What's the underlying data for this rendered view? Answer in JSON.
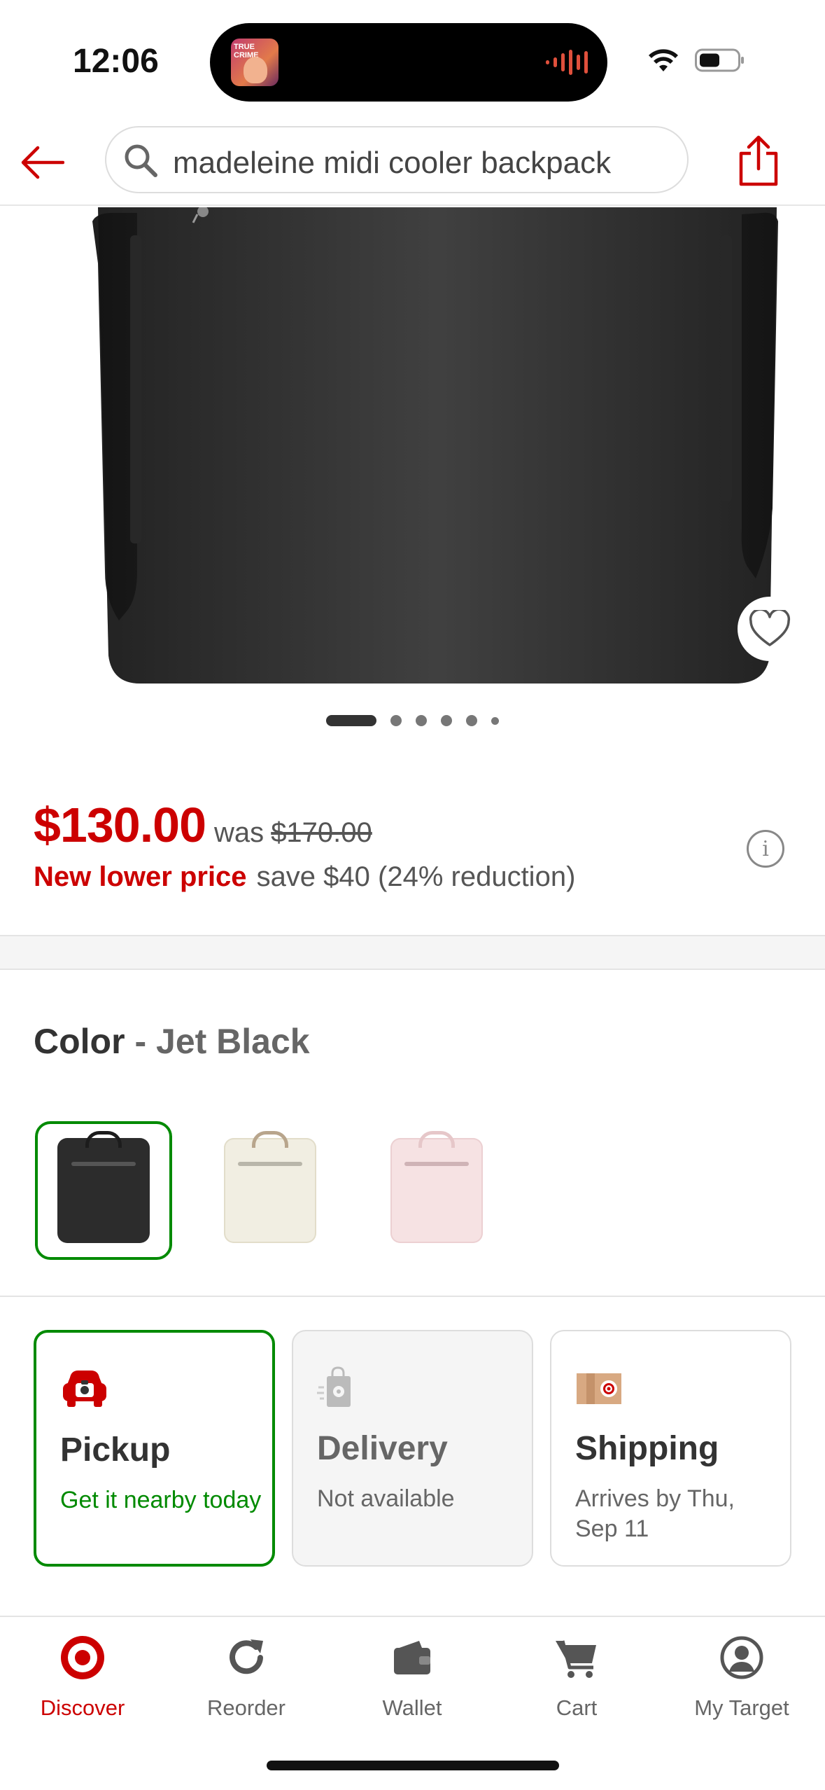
{
  "status_bar": {
    "time": "12:06",
    "island_thumb_text": "TRUE CRIME"
  },
  "header": {
    "search_text": "madeleine midi cooler backpack"
  },
  "price": {
    "current": "$130.00",
    "was_label": "was",
    "was_price": "$170.00",
    "promo": "New lower price",
    "save": "save $40 (24% reduction)"
  },
  "gallery": {
    "image_count": 6,
    "active_index": 0
  },
  "color": {
    "label": "Color",
    "separator": "-",
    "selected": "Jet Black",
    "swatches": [
      "black",
      "cream",
      "pink"
    ]
  },
  "fulfillment": [
    {
      "title": "Pickup",
      "subtitle": "Get it nearby today"
    },
    {
      "title": "Delivery",
      "subtitle": "Not available"
    },
    {
      "title": "Shipping",
      "subtitle": "Arrives by Thu, Sep 11"
    }
  ],
  "tabs": [
    {
      "label": "Discover"
    },
    {
      "label": "Reorder"
    },
    {
      "label": "Wallet"
    },
    {
      "label": "Cart"
    },
    {
      "label": "My Target"
    }
  ],
  "colors": {
    "brand_red": "#cc0000",
    "selected_green": "#008a00"
  },
  "icons": [
    "back-arrow-icon",
    "search-icon",
    "share-icon",
    "heart-icon",
    "info-icon",
    "pickup-car-icon",
    "delivery-bag-icon",
    "shipping-box-icon",
    "target-logo-icon",
    "reorder-icon",
    "wallet-icon",
    "cart-icon",
    "profile-icon"
  ]
}
